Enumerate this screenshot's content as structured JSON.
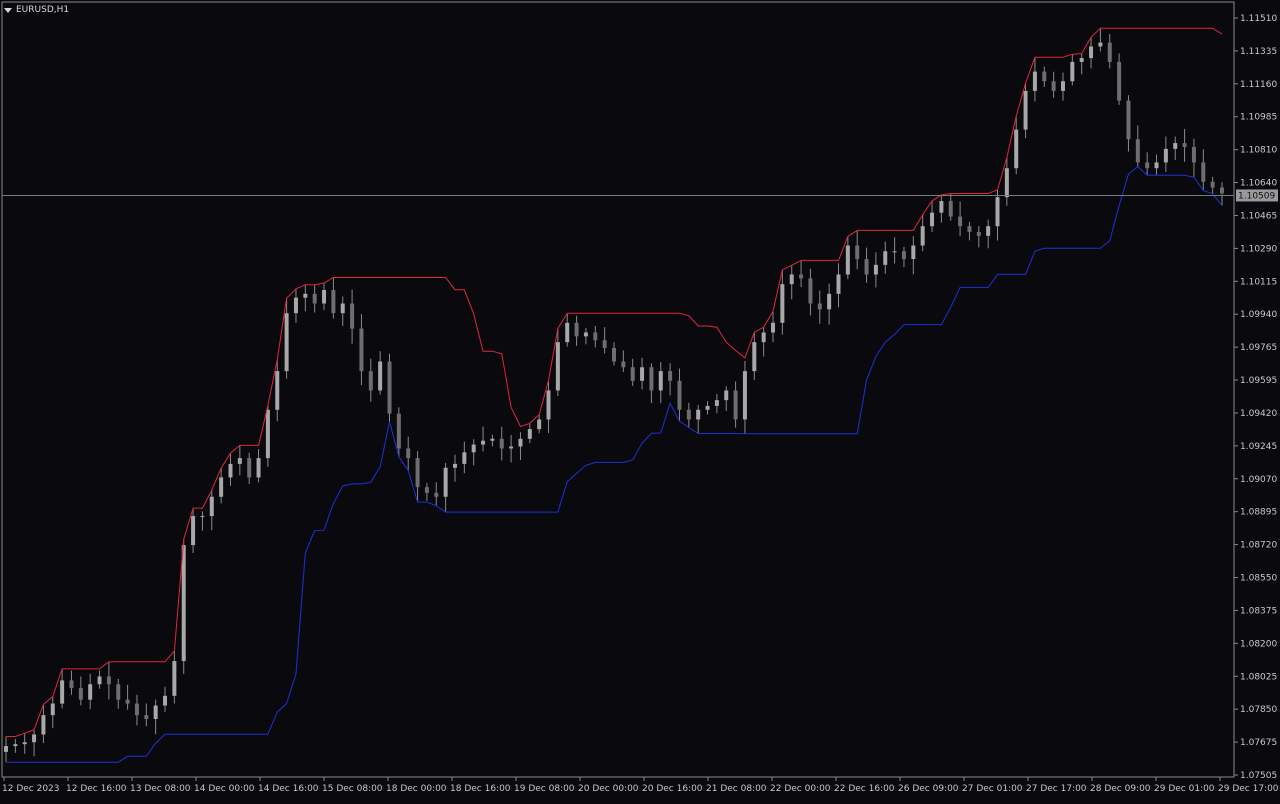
{
  "window": {
    "symbol_title": "EURUSD,H1"
  },
  "colors": {
    "background": "#0a0a0e",
    "grid_frame": "#8a8a8a",
    "candle": "#8c8c8c",
    "upper_band": "#e0243c",
    "lower_band": "#1f2fd8",
    "price_line": "#7a7a7a",
    "price_label_bg": "#9a9a9a",
    "price_label_text": "#101010"
  },
  "chart_data": {
    "type": "candlestick",
    "title": "EURUSD,H1",
    "ylim": [
      1.075,
      1.1151
    ],
    "y_ticks": [
      "1.11510",
      "1.11335",
      "1.11160",
      "1.10985",
      "1.10810",
      "1.10640",
      "1.10465",
      "1.10290",
      "1.10115",
      "1.09940",
      "1.09765",
      "1.09595",
      "1.09420",
      "1.09245",
      "1.09070",
      "1.08895",
      "1.08720",
      "1.08550",
      "1.08375",
      "1.08200",
      "1.08025",
      "1.07850",
      "1.07675",
      "1.07505"
    ],
    "x_ticks": [
      "12 Dec 2023",
      "12 Dec 16:00",
      "13 Dec 08:00",
      "14 Dec 00:00",
      "14 Dec 16:00",
      "15 Dec 08:00",
      "18 Dec 00:00",
      "18 Dec 16:00",
      "19 Dec 08:00",
      "20 Dec 00:00",
      "20 Dec 16:00",
      "21 Dec 08:00",
      "22 Dec 00:00",
      "22 Dec 16:00",
      "26 Dec 09:00",
      "27 Dec 01:00",
      "27 Dec 17:00",
      "28 Dec 09:00",
      "29 Dec 01:00",
      "29 Dec 17:00"
    ],
    "current_price": "1.10509",
    "current_price_value": 1.10509,
    "x_range": [
      0,
      245
    ],
    "close_series": [
      1.0766,
      1.0767,
      1.0768,
      1.0772,
      1.0782,
      1.0788,
      1.08,
      1.0796,
      1.079,
      1.0798,
      1.0802,
      1.0798,
      1.079,
      1.0788,
      1.0782,
      1.078,
      1.0787,
      1.0792,
      1.081,
      1.087,
      1.0885,
      1.0885,
      1.0895,
      1.0905,
      1.0912,
      1.0915,
      1.0905,
      1.0915,
      1.094,
      1.096,
      1.099,
      1.0998,
      1.1,
      1.0995,
      1.1002,
      1.099,
      1.0995,
      1.0982,
      1.096,
      1.095,
      1.0965,
      1.0938,
      1.092,
      1.0915,
      1.09,
      1.0897,
      1.0895,
      1.091,
      1.0912,
      1.0918,
      1.0922,
      1.0924,
      1.0925,
      1.092,
      1.0921,
      1.0925,
      1.093,
      1.0935,
      1.095,
      1.0975,
      1.0985,
      1.0978,
      1.098,
      1.0976,
      1.0972,
      1.0965,
      1.0962,
      1.0955,
      1.0962,
      1.095,
      1.096,
      1.0955,
      1.094,
      1.0935,
      1.094,
      1.0942,
      1.0945,
      1.095,
      1.0935,
      1.096,
      1.0975,
      1.098,
      1.0985,
      1.1005,
      1.101,
      1.1008,
      1.0995,
      1.0992,
      1.1,
      1.101,
      1.1025,
      1.1018,
      1.101,
      1.1015,
      1.1022,
      1.1022,
      1.1018,
      1.1025,
      1.1035,
      1.1042,
      1.1048,
      1.104,
      1.1035,
      1.1032,
      1.103,
      1.1035,
      1.105,
      1.1065,
      1.1085,
      1.1105,
      1.1115,
      1.111,
      1.1105,
      1.111,
      1.112,
      1.1122,
      1.1128,
      1.113,
      1.112,
      1.11,
      1.108,
      1.1068,
      1.1065,
      1.1068,
      1.1075,
      1.1078,
      1.1076,
      1.1068,
      1.1058,
      1.1055,
      1.1052
    ]
  }
}
